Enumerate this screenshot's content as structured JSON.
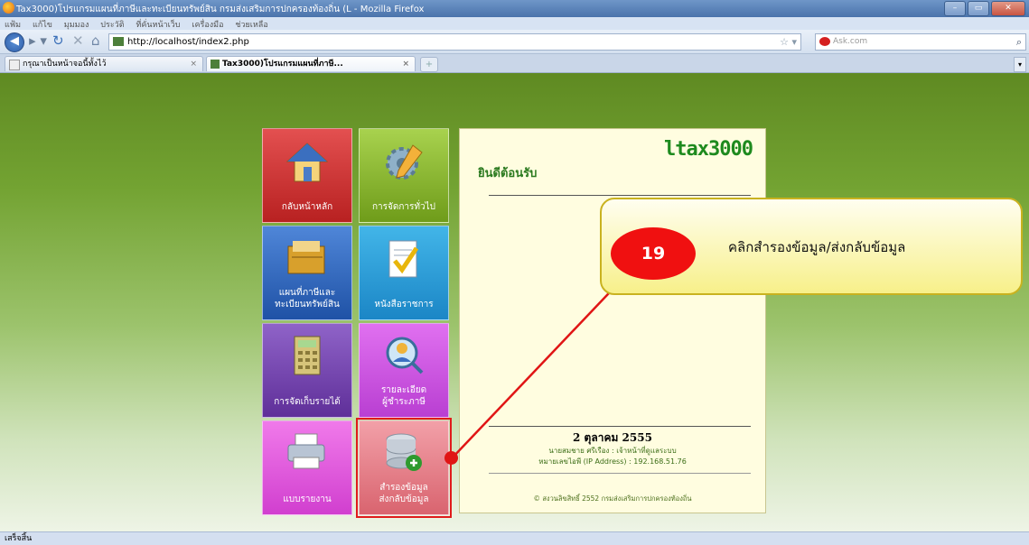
{
  "window": {
    "title": "Tax3000)โปรแกรมแผนที่ภาษีและทะเบียนทรัพย์สิน กรมส่งเสริมการปกครองท้องถิ่น (L - Mozilla Firefox"
  },
  "menu": [
    "แฟ้ม",
    "แก้ไข",
    "มุมมอง",
    "ประวัติ",
    "ที่คั่นหน้าเว็บ",
    "เครื่องมือ",
    "ช่วยเหลือ"
  ],
  "nav": {
    "url": "http://localhost/index2.php",
    "search_placeholder": "Ask.com"
  },
  "tabs": [
    {
      "label": "กรุณาเป็นหน้าจอนี้ทั้งไว้"
    },
    {
      "label": "Tax3000)โปรแกรมแผนที่ภาษี..."
    }
  ],
  "tiles": [
    {
      "label": "กลับหน้าหลัก",
      "color": "#d33535"
    },
    {
      "label": "การจัดการทั่วไป",
      "color": "#8dbb34"
    },
    {
      "label_1": "แผนที่ภาษีและ",
      "label_2": "ทะเบียนทรัพย์สิน",
      "color": "#3a6fc2"
    },
    {
      "label": "หนังสือราชการ",
      "color": "#2aa2da"
    },
    {
      "label": "การจัดเก็บรายได้",
      "color": "#7a4bb5"
    },
    {
      "label_1": "รายละเอียด",
      "label_2": "ผู้ชำระภาษี",
      "color": "#d456e4"
    },
    {
      "label": "แบบรายงาน",
      "color": "#e45ce0"
    },
    {
      "label_1": "สำรองข้อมูล",
      "label_2": "ส่งกลับข้อมูล",
      "color": "#e8848c"
    }
  ],
  "panel": {
    "brand": "ltax3000",
    "welcome": "ยินดีต้อนรับ",
    "date": "2 ตุลาคม 2555",
    "user": "นายสมชาย ศรีเรือง : เจ้าหน้าที่ดูแลระบบ",
    "ip": "หมายเลขไอพี (IP Address) : 192.168.51.76",
    "copyright": "© สงวนลิขสิทธิ์ 2552 กรมส่งเสริมการปกครองท้องถิ่น"
  },
  "callout": {
    "step": "19",
    "text": "คลิกสำรองข้อมูล/ส่งกลับข้อมูล"
  },
  "status": "เสร็จสิ้น"
}
